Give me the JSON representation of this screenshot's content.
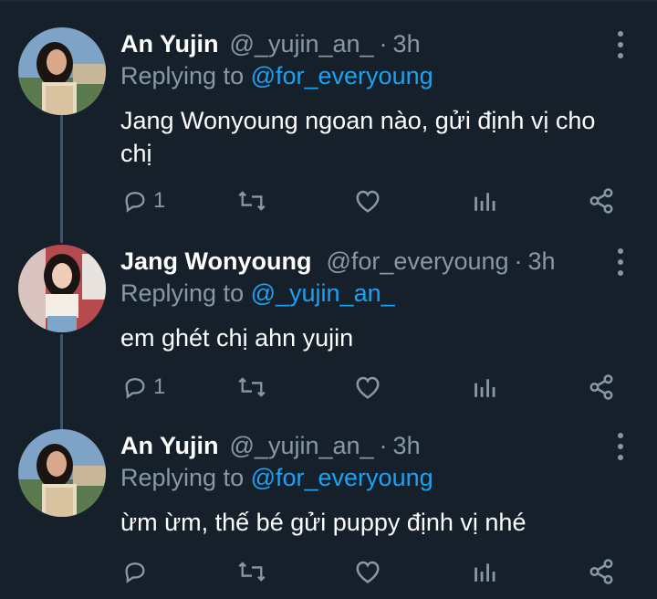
{
  "tweets": [
    {
      "name": "An Yujin",
      "handle": "@_yujin_an_",
      "time": "3h",
      "replying_prefix": "Replying to ",
      "replying_to": "@for_everyoung",
      "text": "Jang Wonyoung ngoan nào, gửi định vị cho chị",
      "reply_count": "1"
    },
    {
      "name": "Jang Wonyoung",
      "handle": "@for_everyoung",
      "time": "3h",
      "replying_prefix": "Replying to ",
      "replying_to": "@_yujin_an_",
      "text": "em ghét chị ahn yujin",
      "reply_count": "1"
    },
    {
      "name": "An Yujin",
      "handle": "@_yujin_an_",
      "time": "3h",
      "replying_prefix": "Replying to ",
      "replying_to": "@for_everyoung",
      "text": "ừm ừm, thế bé gửi puppy định vị nhé",
      "reply_count": ""
    }
  ],
  "separator": "·",
  "icons": [
    "reply-icon",
    "retweet-icon",
    "like-icon",
    "analytics-icon",
    "share-icon",
    "more-icon"
  ],
  "colors": {
    "background": "#15202b",
    "text": "#ffffff",
    "muted": "#8899a6",
    "mention": "#1da1f2",
    "thread_line": "#3d5466"
  }
}
